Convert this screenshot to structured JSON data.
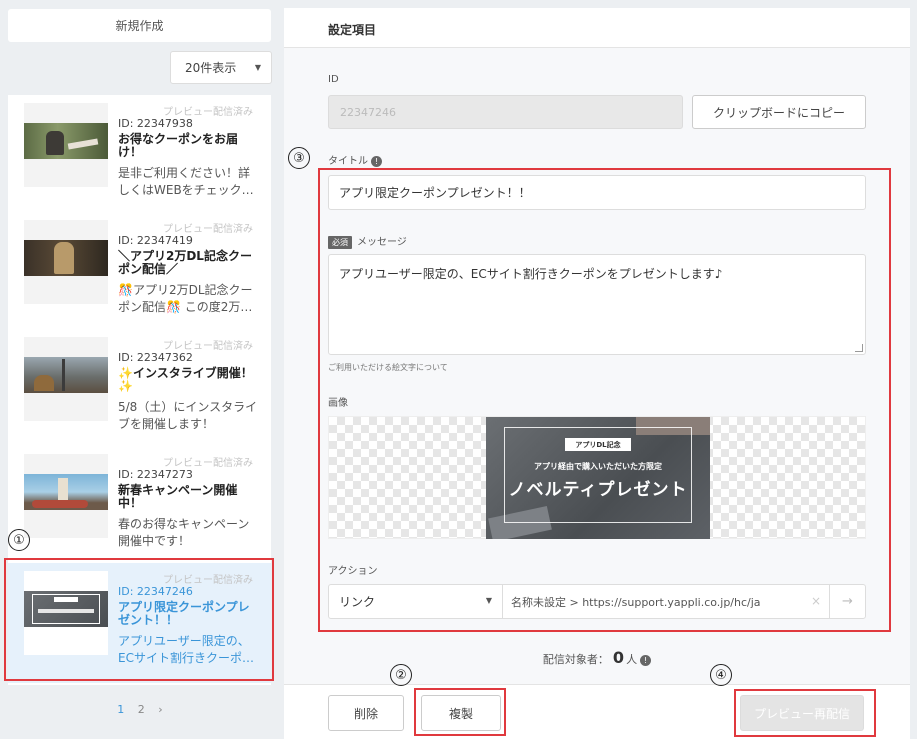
{
  "sidebar": {
    "new_button": "新規作成",
    "count_select": "20件表示",
    "items": [
      {
        "status": "プレビュー配信済み",
        "id": "ID: 22347938",
        "title": "お得なクーポンをお届け！",
        "desc": "是非ご利用ください！詳しくはWEBをチェック…"
      },
      {
        "status": "プレビュー配信済み",
        "id": "ID: 22347419",
        "title": "＼アプリ2万DL記念クーポン配信／",
        "desc": "🎊アプリ2万DL記念クーポン配信🎊 この度2万…"
      },
      {
        "status": "プレビュー配信済み",
        "id": "ID: 22347362",
        "title": "✨インスタライブ開催！✨",
        "desc": "5/8（土）にインスタライブを開催します！"
      },
      {
        "status": "プレビュー配信済み",
        "id": "ID: 22347273",
        "title": "新春キャンペーン開催中！",
        "desc": "春のお得なキャンペーン開催中です！"
      },
      {
        "status": "プレビュー配信済み",
        "id": "ID: 22347246",
        "title": "アプリ限定クーポンプレゼント！！",
        "desc": "アプリユーザー限定の、ECサイト割行きクーポ…"
      }
    ],
    "pager": {
      "page1": "1",
      "page2": "2",
      "next": "›"
    }
  },
  "panel": {
    "header": "設定項目",
    "id_label": "ID",
    "id_value": "22347246",
    "copy_button": "クリップボードにコピー",
    "title_label": "タイトル",
    "title_value": "アプリ限定クーポンプレゼント！！",
    "required_badge": "必須",
    "message_label": "メッセージ",
    "message_value": "アプリユーザー限定の、ECサイト割行きクーポンをプレゼントします♪",
    "emoji_note": "ご利用いただける絵文字について",
    "image_label": "画像",
    "banner": {
      "tag": "アプリDL記念",
      "sub": "アプリ経由で購入いただいた方限定",
      "main": "ノベルティプレゼント"
    },
    "action_label": "アクション",
    "action_type": "リンク",
    "action_url": "名称未設定 > https://support.yappli.co.jp/hc/ja",
    "audience_label": "配信対象者：",
    "audience_count": "0",
    "audience_unit": "人",
    "delete_button": "削除",
    "duplicate_button": "複製",
    "resend_button": "プレビュー再配信"
  },
  "annotations": {
    "n1": "①",
    "n2": "②",
    "n3": "③",
    "n4": "④"
  },
  "colors": {
    "accent": "#3a95d8",
    "selected_bg": "#e6f1fb",
    "annotation_red": "#e0393e"
  }
}
